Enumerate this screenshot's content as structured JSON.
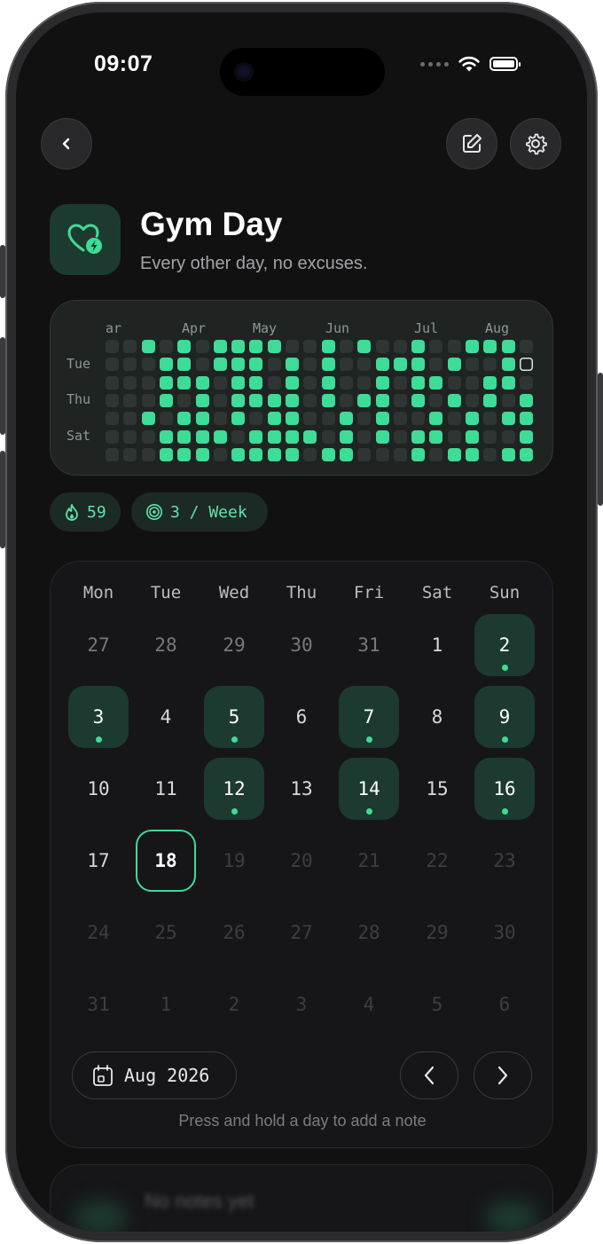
{
  "status_bar": {
    "time": "09:07"
  },
  "header": {
    "back_icon": "chevron-left-icon",
    "edit_icon": "edit-icon",
    "settings_icon": "gear-icon"
  },
  "habit": {
    "title": "Gym Day",
    "subtitle": "Every other day, no excuses.",
    "icon": "heart-bolt-icon",
    "accent": "#3ddc97"
  },
  "heatmap": {
    "months": [
      "ar",
      "Apr",
      "May",
      "Jun",
      "Jul",
      "Aug"
    ],
    "weekday_labels": [
      "Tue",
      "Thu",
      "Sat"
    ]
  },
  "stats": {
    "streak": "59",
    "goal": "3 / Week"
  },
  "calendar": {
    "weekdays": [
      "Mon",
      "Tue",
      "Wed",
      "Thu",
      "Fri",
      "Sat",
      "Sun"
    ],
    "weeks": [
      [
        "27",
        "28",
        "29",
        "30",
        "31",
        "1",
        "2"
      ],
      [
        "3",
        "4",
        "5",
        "6",
        "7",
        "8",
        "9"
      ],
      [
        "10",
        "11",
        "12",
        "13",
        "14",
        "15",
        "16"
      ],
      [
        "17",
        "18",
        "19",
        "20",
        "21",
        "22",
        "23"
      ],
      [
        "24",
        "25",
        "26",
        "27",
        "28",
        "29",
        "30"
      ],
      [
        "31",
        "1",
        "2",
        "3",
        "4",
        "5",
        "6"
      ]
    ],
    "month_label": "Aug 2026",
    "hint": "Press and hold a day to add a note"
  },
  "notes": {
    "empty_text": "No notes yet"
  }
}
